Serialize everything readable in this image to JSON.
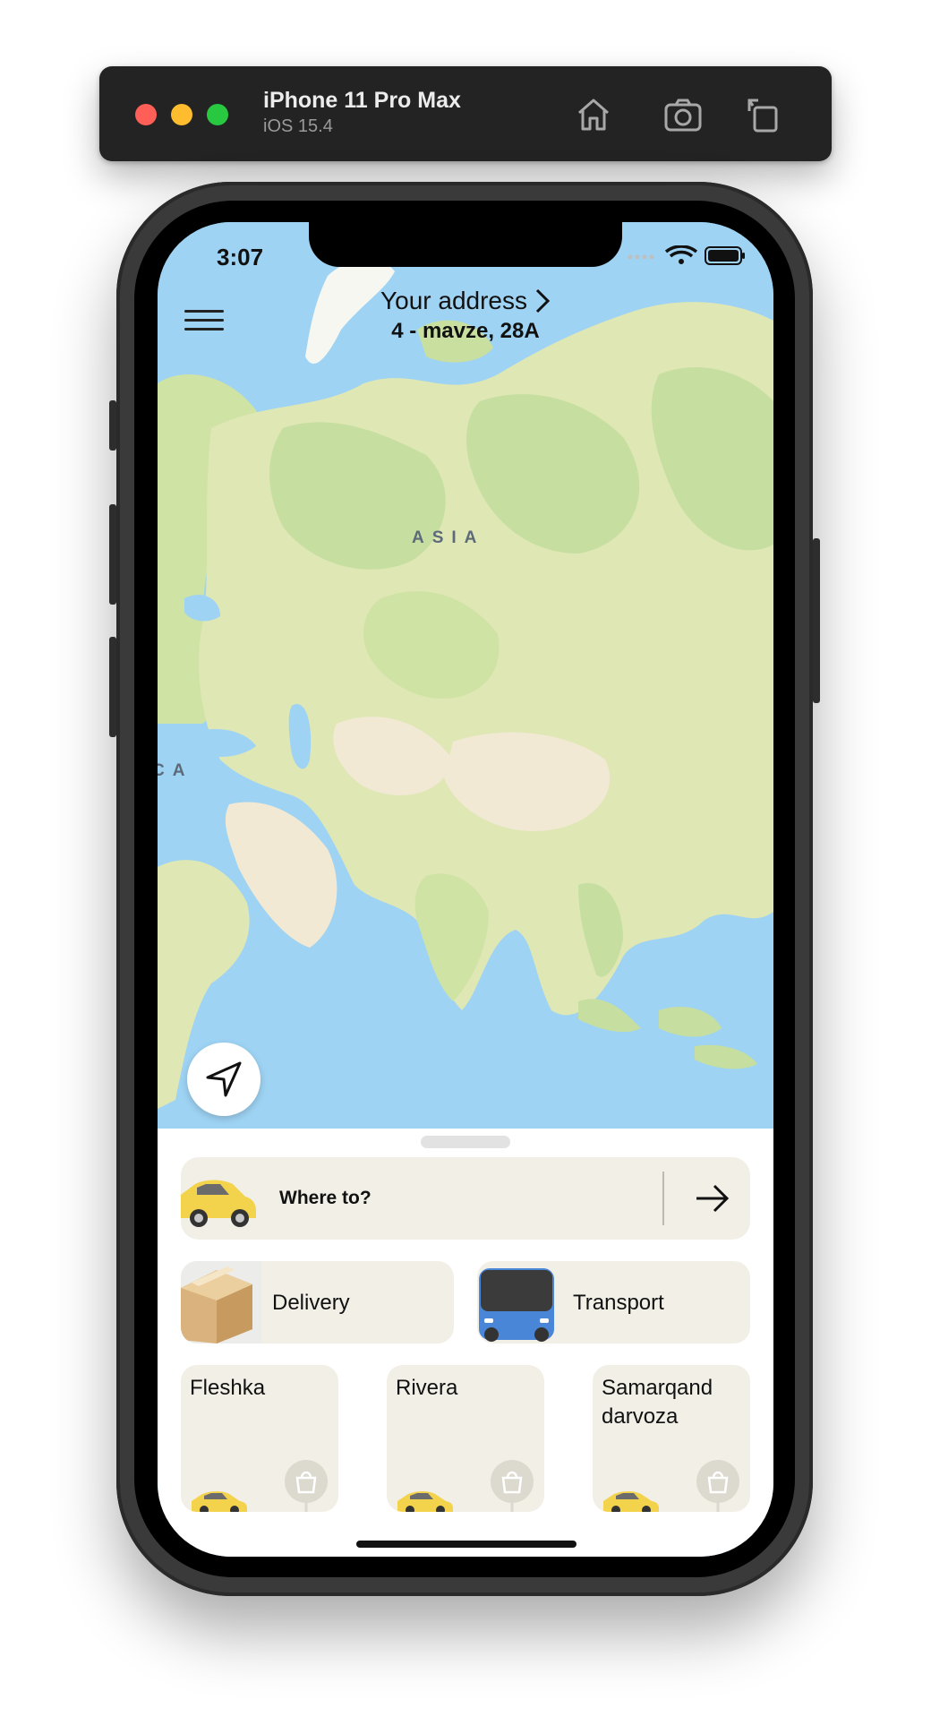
{
  "simulator": {
    "device_name": "iPhone 11 Pro Max",
    "os_version": "iOS 15.4",
    "buttons": [
      "home-icon",
      "screenshot-icon",
      "rotate-icon"
    ]
  },
  "status_bar": {
    "time": "3:07"
  },
  "header": {
    "address_label": "Your address",
    "address_value": "4 - mavze, 28A"
  },
  "map": {
    "labels": {
      "asia": "ASIA",
      "africa_fragment": "CA"
    },
    "colors": {
      "water": "#9ed3f3",
      "land": "#dfe7b5",
      "forest": "#c6dfa0",
      "desert": "#f1e9d3"
    }
  },
  "sheet": {
    "where_to": "Where to?",
    "services": [
      {
        "label": "Delivery"
      },
      {
        "label": "Transport"
      }
    ],
    "places": [
      {
        "name": "Fleshka"
      },
      {
        "name": "Rivera"
      },
      {
        "name": "Samarqand darvoza"
      }
    ]
  },
  "colors": {
    "card_bg": "#f1efe6",
    "taxi_yellow": "#f3d24c"
  }
}
